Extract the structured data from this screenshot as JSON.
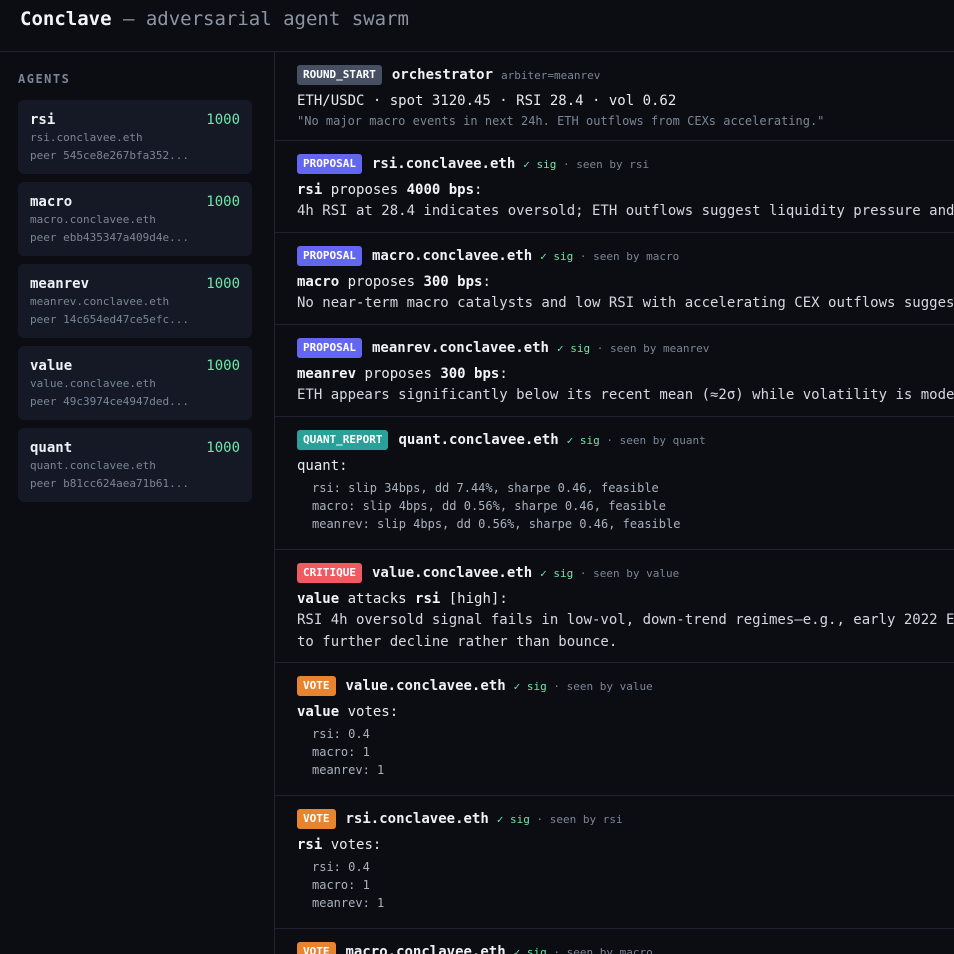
{
  "header": {
    "brand": "Conclave",
    "tagline": " — adversarial agent swarm"
  },
  "sidebar": {
    "title": "AGENTS",
    "agents": [
      {
        "name": "rsi",
        "score": "1000",
        "ens": "rsi.conclavee.eth",
        "peer": "peer 545ce8e267bfa352..."
      },
      {
        "name": "macro",
        "score": "1000",
        "ens": "macro.conclavee.eth",
        "peer": "peer ebb435347a409d4e..."
      },
      {
        "name": "meanrev",
        "score": "1000",
        "ens": "meanrev.conclavee.eth",
        "peer": "peer 14c654ed47ce5efc..."
      },
      {
        "name": "value",
        "score": "1000",
        "ens": "value.conclavee.eth",
        "peer": "peer 49c3974ce4947ded..."
      },
      {
        "name": "quant",
        "score": "1000",
        "ens": "quant.conclavee.eth",
        "peer": "peer b81cc624aea71b61..."
      }
    ]
  },
  "colors": {
    "round_start": "#475063",
    "proposal": "#6366f1",
    "quant_report": "#2aa198",
    "critique": "#f05a63",
    "vote": "#e8832e"
  },
  "feed": {
    "round": {
      "badge": "ROUND_START",
      "actor": "orchestrator",
      "meta": "arbiter=meanrev",
      "market": "ETH/USDC · spot 3120.45 · RSI 28.4 · vol 0.62",
      "note": "\"No major macro events in next 24h. ETH outflows from CEXs accelerating.\""
    },
    "sig": "✓ sig",
    "proposals": [
      {
        "badge": "PROPOSAL",
        "actor": "rsi.conclavee.eth",
        "seen": " · seen by rsi",
        "agent": "rsi",
        "verb": " proposes ",
        "bps": "4000 bps",
        "colon": ":",
        "text": "4h RSI at 28.4 indicates oversold; ETH outflows suggest liquidity pressure and"
      },
      {
        "badge": "PROPOSAL",
        "actor": "macro.conclavee.eth",
        "seen": " · seen by macro",
        "agent": "macro",
        "verb": " proposes ",
        "bps": "300 bps",
        "colon": ":",
        "text": "No near-term macro catalysts and low RSI with accelerating CEX outflows sugges"
      },
      {
        "badge": "PROPOSAL",
        "actor": "meanrev.conclavee.eth",
        "seen": " · seen by meanrev",
        "agent": "meanrev",
        "verb": " proposes ",
        "bps": "300 bps",
        "colon": ":",
        "text": "ETH appears significantly below its recent mean (≈2σ) while volatility is mode"
      }
    ],
    "quant": {
      "badge": "QUANT_REPORT",
      "actor": "quant.conclavee.eth",
      "seen": " · seen by quant",
      "label": "quant:",
      "lines": [
        "rsi: slip 34bps, dd 7.44%, sharpe 0.46, feasible",
        "macro: slip 4bps, dd 0.56%, sharpe 0.46, feasible",
        "meanrev: slip 4bps, dd 0.56%, sharpe 0.46, feasible"
      ]
    },
    "critique": {
      "badge": "CRITIQUE",
      "actor": "value.conclavee.eth",
      "seen": " · seen by value",
      "agent": "value",
      "verb": " attacks ",
      "target": "rsi",
      "severity": " [high]:",
      "text1": "RSI 4h oversold signal fails in low-vol, down-trend regimes—e.g., early 2022 E",
      "text2": "to further decline rather than bounce."
    },
    "votes": [
      {
        "badge": "VOTE",
        "actor": "value.conclavee.eth",
        "seen": " · seen by value",
        "agent": "value",
        "verb": " votes:",
        "lines": [
          "rsi: 0.4",
          "macro: 1",
          "meanrev: 1"
        ]
      },
      {
        "badge": "VOTE",
        "actor": "rsi.conclavee.eth",
        "seen": " · seen by rsi",
        "agent": "rsi",
        "verb": " votes:",
        "lines": [
          "rsi: 0.4",
          "macro: 1",
          "meanrev: 1"
        ]
      },
      {
        "badge": "VOTE",
        "actor": "macro.conclavee.eth",
        "seen": " · seen by macro",
        "agent": "",
        "verb": "",
        "lines": []
      }
    ]
  }
}
